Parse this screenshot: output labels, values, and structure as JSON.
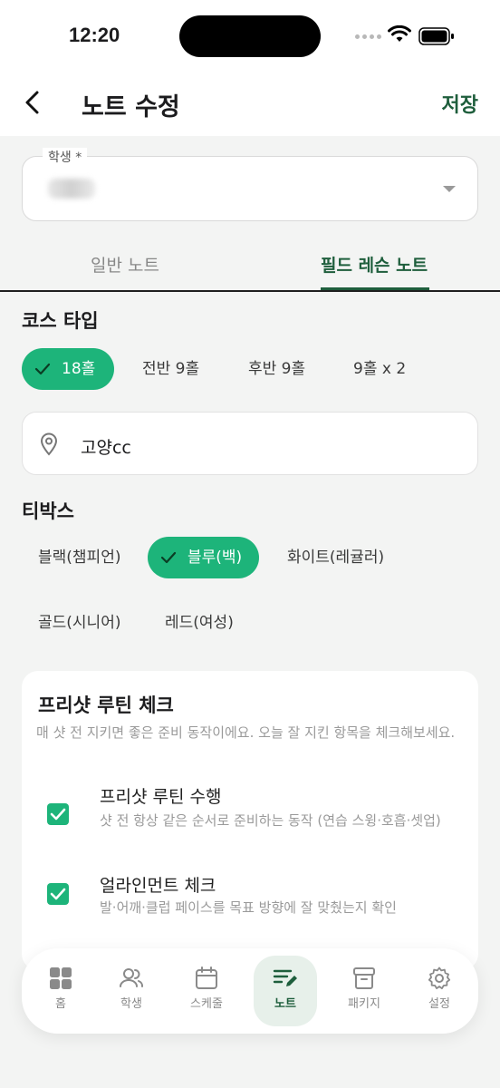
{
  "status_bar": {
    "time": "12:20"
  },
  "header": {
    "title": "노트 수정",
    "save_label": "저장"
  },
  "student_field": {
    "label": "학생 *"
  },
  "tabs": [
    {
      "label": "일반 노트",
      "active": false
    },
    {
      "label": "필드 레슨 노트",
      "active": true
    }
  ],
  "course_type": {
    "title": "코스 타입",
    "options": [
      "18홀",
      "전반 9홀",
      "후반 9홀",
      "9홀 x 2"
    ],
    "selected": "18홀"
  },
  "location": {
    "value": "고양cc"
  },
  "tee_box": {
    "title": "티박스",
    "options": [
      "블랙(챔피언)",
      "블루(백)",
      "화이트(레귤러)",
      "골드(시니어)",
      "레드(여성)"
    ],
    "selected": "블루(백)"
  },
  "routine_card": {
    "title": "프리샷 루틴 체크",
    "description": "매 샷 전 지키면 좋은 준비 동작이에요. 오늘 잘 지킨 항목을 체크해보세요.",
    "items": [
      {
        "title": "프리샷 루틴 수행",
        "description": "샷 전 항상 같은 순서로 준비하는 동작 (연습 스윙·호흡·셋업)",
        "checked": true
      },
      {
        "title": "얼라인먼트 체크",
        "description": "발·어깨·클럽 페이스를 목표 방향에 잘 맞췄는지 확인",
        "checked": true
      }
    ]
  },
  "bottom_nav": [
    {
      "label": "홈",
      "icon": "grid-icon"
    },
    {
      "label": "학생",
      "icon": "users-icon"
    },
    {
      "label": "스케줄",
      "icon": "calendar-icon"
    },
    {
      "label": "노트",
      "icon": "note-edit-icon",
      "active": true
    },
    {
      "label": "패키지",
      "icon": "archive-icon"
    },
    {
      "label": "설정",
      "icon": "gear-icon"
    }
  ],
  "colors": {
    "accent": "#1db47a",
    "brand_dark": "#1e5e3c",
    "background": "#f3f4f3"
  }
}
